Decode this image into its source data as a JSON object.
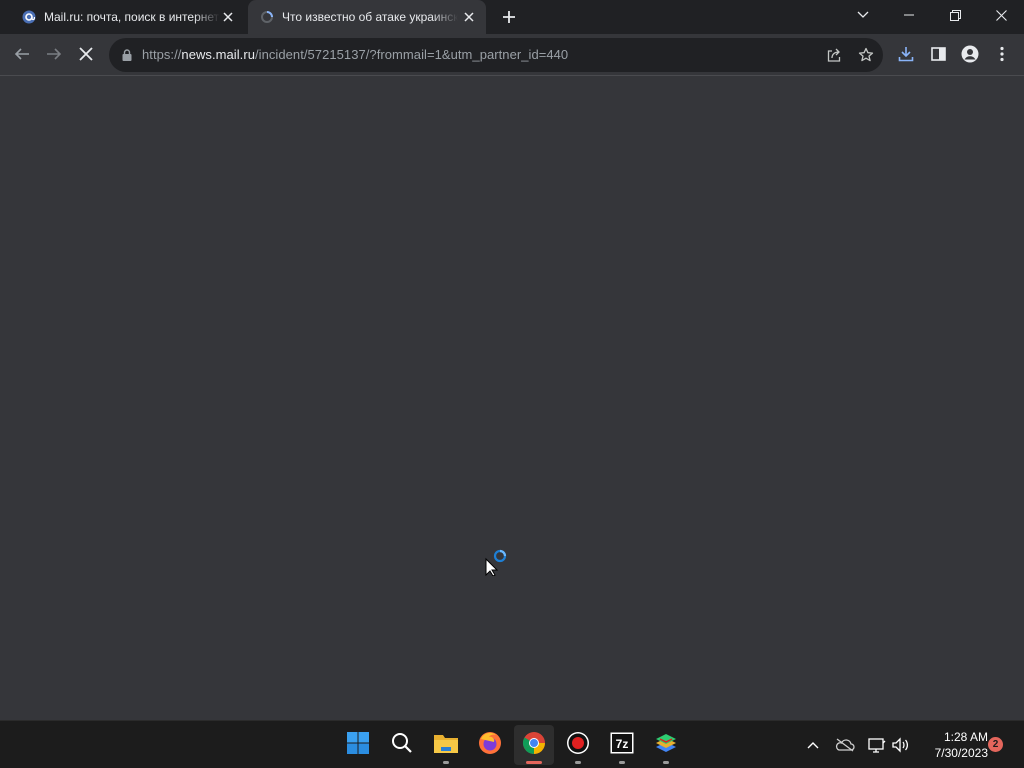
{
  "tabs": [
    {
      "title": "Mail.ru: почта, поиск в интернете, новости, игры",
      "active": false,
      "favicon": "mailru-icon"
    },
    {
      "title": "Что известно об атаке украинских беспилотников",
      "active": true,
      "favicon": "loading-spinner-icon"
    }
  ],
  "toolbar": {
    "url_scheme": "https://",
    "url_host": "news.mail.ru",
    "url_path": "/incident/57215137/?frommail=1&utm_partner_id=440"
  },
  "page": {
    "loading": true,
    "background": "#35363a"
  },
  "taskbar": {
    "apps": [
      {
        "name": "start-button",
        "icon": "windows-logo-icon",
        "running": false,
        "active": false
      },
      {
        "name": "search-button",
        "icon": "search-icon",
        "running": false,
        "active": false
      },
      {
        "name": "file-explorer",
        "icon": "folder-icon",
        "running": true,
        "active": false
      },
      {
        "name": "firefox",
        "icon": "firefox-icon",
        "running": false,
        "active": false
      },
      {
        "name": "chrome",
        "icon": "chrome-icon",
        "running": true,
        "active": true
      },
      {
        "name": "screen-recorder",
        "icon": "record-icon",
        "running": true,
        "active": false
      },
      {
        "name": "7zip",
        "icon": "7zip-icon",
        "running": true,
        "active": false
      },
      {
        "name": "bluestacks",
        "icon": "bluestacks-icon",
        "running": true,
        "active": false
      }
    ],
    "clock": {
      "time": "1:28 AM",
      "date": "7/30/2023"
    },
    "notification_count": "2"
  },
  "colors": {
    "accent": "#e4665c",
    "tab_bg": "#202124",
    "chrome_bg": "#35363a",
    "taskbar_bg": "#1c1c1c"
  }
}
